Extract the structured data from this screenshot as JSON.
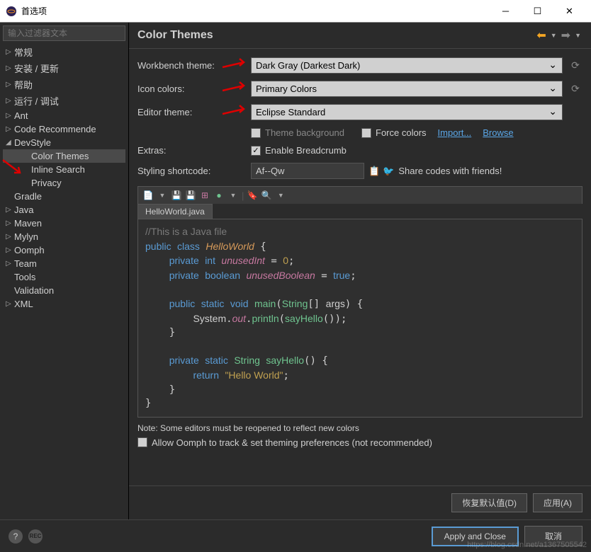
{
  "window": {
    "title": "首选项"
  },
  "sidebar": {
    "filter_placeholder": "输入过滤器文本",
    "items": [
      {
        "label": "常规",
        "arrow": "▷",
        "level": 1
      },
      {
        "label": "安装 / 更新",
        "arrow": "▷",
        "level": 1
      },
      {
        "label": "帮助",
        "arrow": "▷",
        "level": 1
      },
      {
        "label": "运行 / 调试",
        "arrow": "▷",
        "level": 1
      },
      {
        "label": "Ant",
        "arrow": "▷",
        "level": 1
      },
      {
        "label": "Code Recommende",
        "arrow": "▷",
        "level": 1
      },
      {
        "label": "DevStyle",
        "arrow": "◢",
        "level": 1
      },
      {
        "label": "Color Themes",
        "arrow": "",
        "level": 2,
        "selected": true
      },
      {
        "label": "Inline Search",
        "arrow": "",
        "level": 2
      },
      {
        "label": "Privacy",
        "arrow": "",
        "level": 2
      },
      {
        "label": "Gradle",
        "arrow": "",
        "level": 1
      },
      {
        "label": "Java",
        "arrow": "▷",
        "level": 1
      },
      {
        "label": "Maven",
        "arrow": "▷",
        "level": 1
      },
      {
        "label": "Mylyn",
        "arrow": "▷",
        "level": 1
      },
      {
        "label": "Oomph",
        "arrow": "▷",
        "level": 1
      },
      {
        "label": "Team",
        "arrow": "▷",
        "level": 1
      },
      {
        "label": "Tools",
        "arrow": "",
        "level": 1
      },
      {
        "label": "Validation",
        "arrow": "",
        "level": 1
      },
      {
        "label": "XML",
        "arrow": "▷",
        "level": 1
      }
    ]
  },
  "content": {
    "title": "Color Themes",
    "workbench_label": "Workbench theme:",
    "workbench_value": "Dark Gray (Darkest Dark)",
    "icon_label": "Icon colors:",
    "icon_value": "Primary Colors",
    "editor_label": "Editor theme:",
    "editor_value": "Eclipse Standard",
    "theme_bg_label": "Theme background",
    "force_colors_label": "Force colors",
    "import_link": "Import...",
    "browse_link": "Browse",
    "extras_label": "Extras:",
    "breadcrumb_label": "Enable Breadcrumb",
    "shortcode_label": "Styling shortcode:",
    "shortcode_value": "Af--Qw",
    "share_label": "Share codes with friends!",
    "editor_tab": "HelloWorld.java",
    "note": "Note: Some editors must be reopened to reflect new colors",
    "oomph_label": "Allow Oomph to track & set theming preferences (not recommended)",
    "restore_btn": "恢复默认值(D)",
    "apply_btn": "应用(A)"
  },
  "code": {
    "comment": "//This is a Java file",
    "kw_public": "public",
    "kw_class": "class",
    "cls": "HelloWorld",
    "kw_private": "private",
    "t_int": "int",
    "f_unusedInt": "unusedInt",
    "n_zero": "0",
    "t_boolean": "boolean",
    "f_unusedBoolean": "unusedBoolean",
    "b_true": "true",
    "kw_static": "static",
    "t_void": "void",
    "m_main": "main",
    "t_String": "String",
    "p_args": "args",
    "sys": "System",
    "out": "out",
    "println": "println",
    "sayHello": "sayHello",
    "kw_return": "return",
    "s_hello": "\"Hello World\""
  },
  "bottom": {
    "apply_close": "Apply and Close",
    "cancel": "取消"
  },
  "watermark": "https://blog.csdn.net/a1367505542"
}
